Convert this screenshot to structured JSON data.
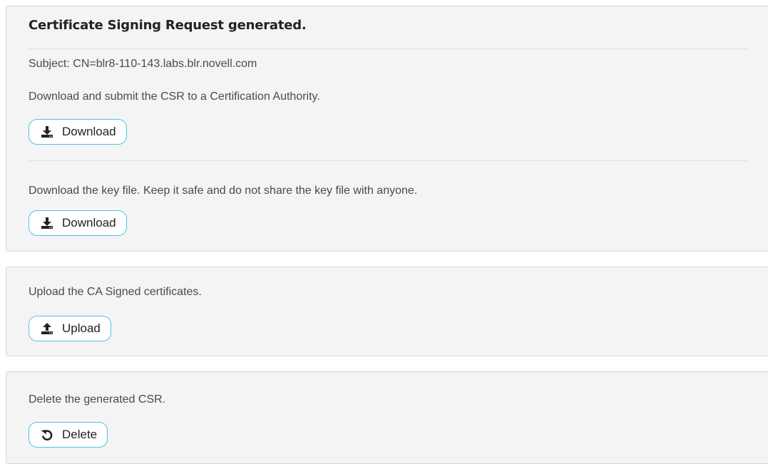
{
  "csr_panel": {
    "title": "Certificate Signing Request generated.",
    "subject": "Subject: CN=blr8-110-143.labs.blr.novell.com",
    "csr_instruction": "Download and submit the CSR to a Certification Authority.",
    "csr_download_label": "Download",
    "key_instruction": "Download the key file. Keep it safe and do not share the key file with anyone.",
    "key_download_label": "Download"
  },
  "upload_panel": {
    "instruction": "Upload the CA Signed certificates.",
    "upload_label": "Upload"
  },
  "delete_panel": {
    "instruction": "Delete the generated CSR.",
    "delete_label": "Delete"
  },
  "icons": {
    "download": "download-icon",
    "upload": "upload-icon",
    "delete": "undo-icon"
  },
  "colors": {
    "button_border": "#4fc3e8",
    "panel_background": "#f4f4f4"
  }
}
